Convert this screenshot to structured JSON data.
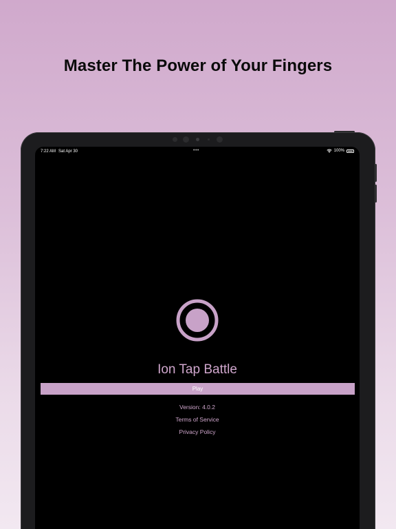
{
  "headline": "Master The Power of Your Fingers",
  "status_bar": {
    "time": "7:22 AM",
    "date": "Sat Apr 30",
    "multitask_dots": "•••",
    "battery": "100%"
  },
  "app": {
    "title": "Ion Tap Battle",
    "play_label": "Play",
    "version": "Version: 4.0.2",
    "terms_label": "Terms of Service",
    "privacy_label": "Privacy Policy"
  },
  "colors": {
    "accent": "#c8a2c8",
    "screen_bg": "#000000",
    "background_top": "#d0a9cc",
    "background_bottom": "#f2e8f1"
  },
  "icons": {
    "logo": "ring-dot-icon",
    "wifi": "wifi-icon",
    "battery": "battery-icon"
  }
}
